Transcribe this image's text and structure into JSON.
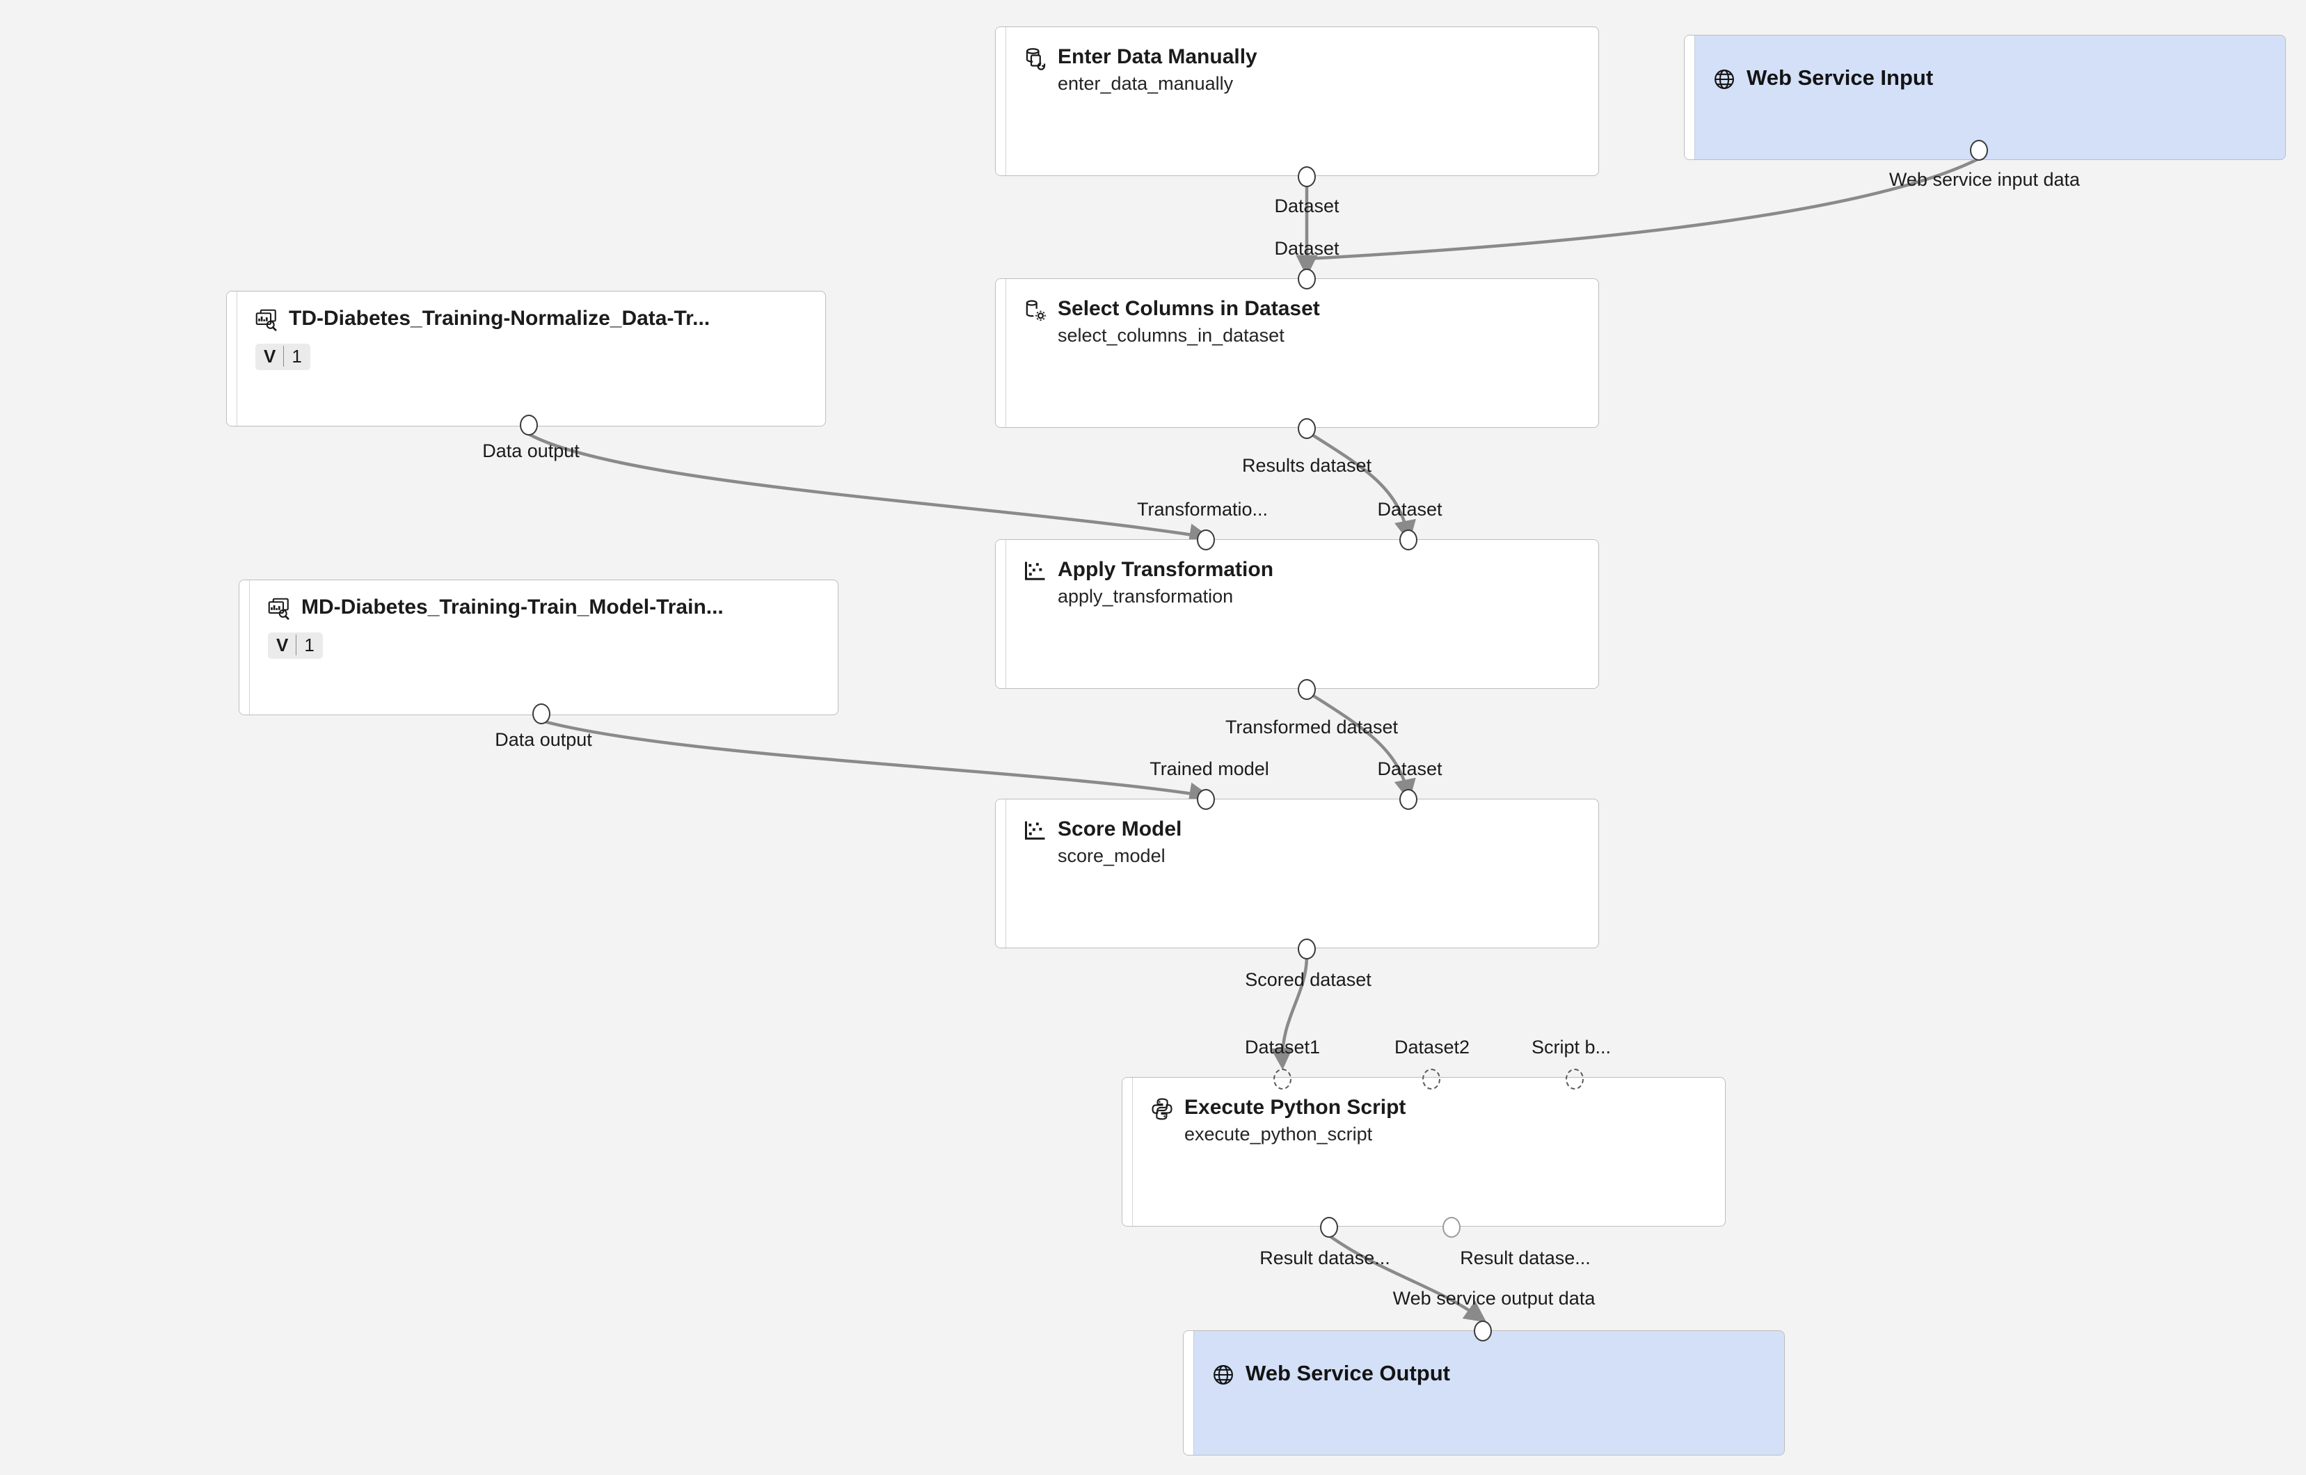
{
  "canvas": {
    "background": "#f3f3f3",
    "edge_color": "#8a8a8a",
    "webservice_fill": "#d3e0f7",
    "node_fill": "#ffffff",
    "node_border": "#bdbdbd"
  },
  "nodes": [
    {
      "id": "enter_data_manually",
      "title": "Enter Data Manually",
      "subtitle": "enter_data_manually",
      "icon": "enter-data-manually-icon",
      "kind": "module"
    },
    {
      "id": "web_service_input",
      "title": "Web Service Input",
      "subtitle": "",
      "icon": "globe-icon",
      "kind": "webservice"
    },
    {
      "id": "td_normalize_data",
      "title": "TD-Diabetes_Training-Normalize_Data-Tr...",
      "subtitle": "",
      "icon": "dataset-report-icon",
      "kind": "dataset",
      "version_label": "V",
      "version_number": "1"
    },
    {
      "id": "select_columns_in_dataset",
      "title": "Select Columns in Dataset",
      "subtitle": "select_columns_in_dataset",
      "icon": "select-columns-icon",
      "kind": "module"
    },
    {
      "id": "md_train_model",
      "title": "MD-Diabetes_Training-Train_Model-Train...",
      "subtitle": "",
      "icon": "dataset-report-icon",
      "kind": "dataset",
      "version_label": "V",
      "version_number": "1"
    },
    {
      "id": "apply_transformation",
      "title": "Apply Transformation",
      "subtitle": "apply_transformation",
      "icon": "scatter-plot-icon",
      "kind": "module"
    },
    {
      "id": "score_model",
      "title": "Score Model",
      "subtitle": "score_model",
      "icon": "scatter-plot-icon",
      "kind": "module"
    },
    {
      "id": "execute_python_script",
      "title": "Execute Python Script",
      "subtitle": "execute_python_script",
      "icon": "python-icon",
      "kind": "module"
    },
    {
      "id": "web_service_output",
      "title": "Web Service Output",
      "subtitle": "",
      "icon": "globe-icon",
      "kind": "webservice"
    }
  ],
  "port_labels": {
    "enter_data_out": "Dataset",
    "select_columns_in": "Dataset",
    "web_service_input_out": "Web service input data",
    "td_normalize_out": "Data output",
    "select_columns_out": "Results dataset",
    "apply_transformation_in_1": "Transformatio...",
    "apply_transformation_in_2": "Dataset",
    "md_train_model_out": "Data output",
    "apply_transformation_out": "Transformed dataset",
    "score_model_in_1": "Trained model",
    "score_model_in_2": "Dataset",
    "score_model_out": "Scored dataset",
    "python_in_1": "Dataset1",
    "python_in_2": "Dataset2",
    "python_in_3": "Script b...",
    "python_out_1": "Result datase...",
    "python_out_2": "Result datase...",
    "web_service_output_in": "Web service output data"
  }
}
